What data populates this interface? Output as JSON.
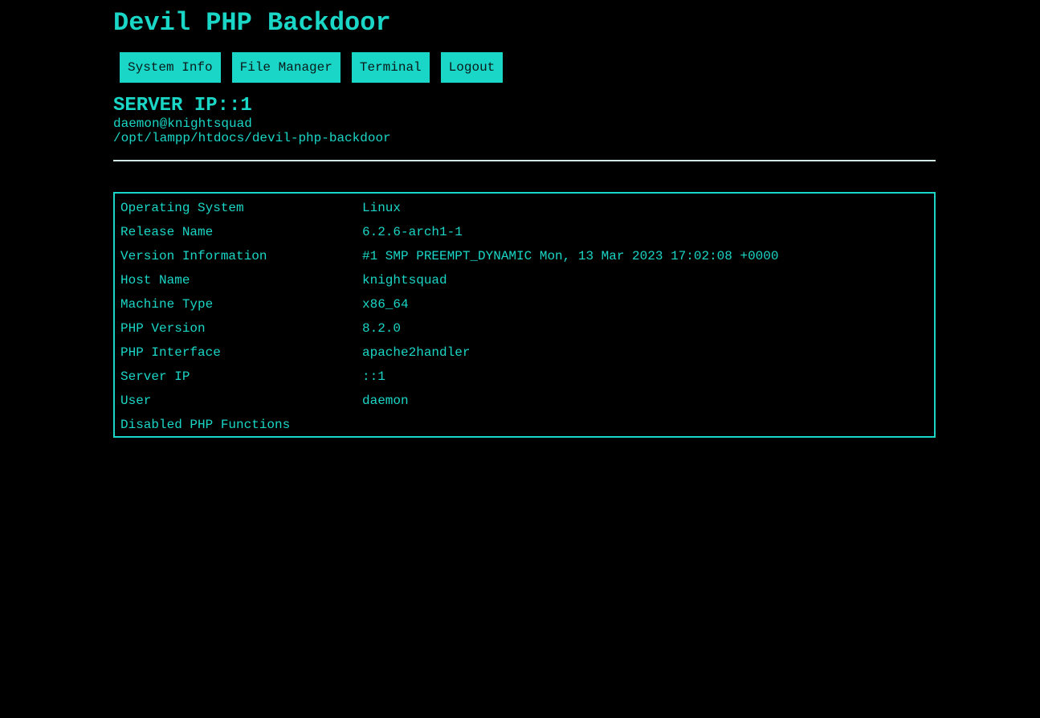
{
  "app": {
    "title": "Devil PHP Backdoor"
  },
  "nav": {
    "items": [
      {
        "label": "System Info"
      },
      {
        "label": "File Manager"
      },
      {
        "label": "Terminal"
      },
      {
        "label": "Logout"
      }
    ]
  },
  "server": {
    "ip_heading": "SERVER IP::1",
    "user_host": "daemon@knightsquad",
    "cwd": "/opt/lampp/htdocs/devil-php-backdoor"
  },
  "sysinfo": {
    "rows": [
      {
        "label": "Operating System",
        "value": "Linux"
      },
      {
        "label": "Release Name",
        "value": "6.2.6-arch1-1"
      },
      {
        "label": "Version Information",
        "value": "#1 SMP PREEMPT_DYNAMIC Mon, 13 Mar 2023 17:02:08 +0000"
      },
      {
        "label": "Host Name",
        "value": "knightsquad"
      },
      {
        "label": "Machine Type",
        "value": "x86_64"
      },
      {
        "label": "PHP Version",
        "value": "8.2.0"
      },
      {
        "label": "PHP Interface",
        "value": "apache2handler"
      },
      {
        "label": "Server IP",
        "value": "::1"
      },
      {
        "label": "User",
        "value": "daemon"
      },
      {
        "label": "Disabled PHP Functions",
        "value": ""
      }
    ]
  },
  "colors": {
    "accent": "#1ad6c6",
    "background": "#000000",
    "divider": "#cfe9e6"
  }
}
